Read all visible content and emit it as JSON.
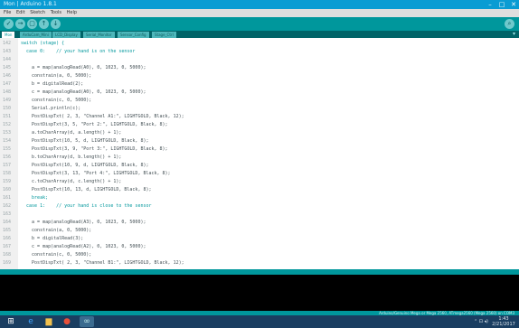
{
  "window": {
    "title": "Mon | Arduino 1.8.1"
  },
  "window_controls": {
    "minimize": "–",
    "maximize": "□",
    "close": "✕"
  },
  "menu": [
    "File",
    "Edit",
    "Sketch",
    "Tools",
    "Help"
  ],
  "toolbar": {
    "verify": "✓",
    "upload": "→",
    "new": "▢",
    "open": "↑",
    "save": "↓",
    "serial_monitor": "⌕"
  },
  "tabs": [
    {
      "label": "Mon",
      "active": true
    },
    {
      "label": "ArduCam_Mini",
      "active": false
    },
    {
      "label": "LCD_Display",
      "active": false
    },
    {
      "label": "Serial_Monitor",
      "active": false
    },
    {
      "label": "Sensor_Config",
      "active": false
    },
    {
      "label": "Stage_Ctrl",
      "active": false
    }
  ],
  "tab_menu": "▾",
  "code_lines": [
    {
      "n": "142",
      "t": "switch (stage) {"
    },
    {
      "n": "143",
      "t": "  case 0:    // your hand is on the sensor"
    },
    {
      "n": "144",
      "t": ""
    },
    {
      "n": "145",
      "t": "    a = map(analogRead(A0), 0, 1023, 0, 5000);"
    },
    {
      "n": "146",
      "t": "    constrain(a, 0, 5000);"
    },
    {
      "n": "147",
      "t": "    b = digitalRead(2);"
    },
    {
      "n": "148",
      "t": "    c = map(analogRead(A0), 0, 1023, 0, 5000);"
    },
    {
      "n": "149",
      "t": "    constrain(c, 0, 5000);"
    },
    {
      "n": "150",
      "t": "    Serial.println(c);"
    },
    {
      "n": "151",
      "t": "    PostDispTxt( 2, 3, \"Channel A1:\", LIGHTGOLD, Black, 12);"
    },
    {
      "n": "152",
      "t": "    PostDispTxt(3, 5, \"Port 2:\", LIGHTGOLD, Black, 8);"
    },
    {
      "n": "153",
      "t": "    a.toCharArray(d, a.length() + 1);"
    },
    {
      "n": "154",
      "t": "    PostDispTxt(10, 5, d, LIGHTGOLD, Black, 8);"
    },
    {
      "n": "155",
      "t": "    PostDispTxt(3, 9, \"Port 3:\", LIGHTGOLD, Black, 8);"
    },
    {
      "n": "156",
      "t": "    b.toCharArray(d, b.length() + 1);"
    },
    {
      "n": "157",
      "t": "    PostDispTxt(10, 9, d, LIGHTGOLD, Black, 8);"
    },
    {
      "n": "158",
      "t": "    PostDispTxt(3, 13, \"Port 4:\", LIGHTGOLD, Black, 8);"
    },
    {
      "n": "159",
      "t": "    c.toCharArray(d, c.length() + 1);"
    },
    {
      "n": "160",
      "t": "    PostDispTxt(10, 13, d, LIGHTGOLD, Black, 8);"
    },
    {
      "n": "161",
      "t": "    break;"
    },
    {
      "n": "162",
      "t": "  case 1:    // your hand is close to the sensor"
    },
    {
      "n": "163",
      "t": ""
    },
    {
      "n": "164",
      "t": "    a = map(analogRead(A3), 0, 1023, 0, 5000);"
    },
    {
      "n": "165",
      "t": "    constrain(a, 0, 5000);"
    },
    {
      "n": "166",
      "t": "    b = digitalRead(3);"
    },
    {
      "n": "167",
      "t": "    c = map(analogRead(A2), 0, 1023, 0, 5000);"
    },
    {
      "n": "168",
      "t": "    constrain(c, 0, 5000);"
    },
    {
      "n": "169",
      "t": "    PostDispTxt( 2, 3, \"Channel B1:\", LIGHTGOLD, Black, 12);"
    }
  ],
  "syntax_colors": {
    "keyword": "#00979c",
    "function": "#d35400",
    "comment": "#95a5a6",
    "string": "#005c5f",
    "plain": "#434f54"
  },
  "statusbar": {
    "left": "",
    "right": "Arduino/Genuino Mega or Mega 2560, ATmega2560 (Mega 2560) on COM3"
  },
  "taskbar": {
    "items": [
      "start-icon",
      "edge-icon",
      "file-explorer-icon",
      "chrome-icon",
      "arduino-icon"
    ],
    "tray_time": "1:43",
    "tray_date": "2/21/2017",
    "tray_icons": "⌃ ⊡ ◂)"
  }
}
